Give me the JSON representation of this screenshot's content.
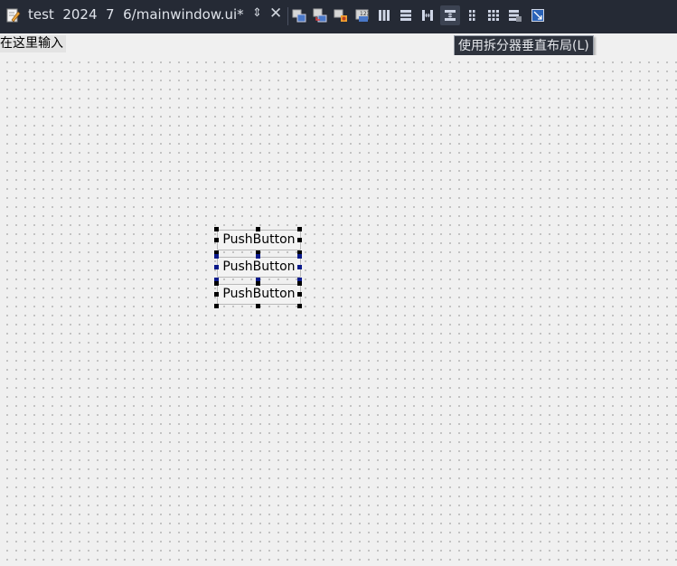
{
  "toolbar": {
    "document_title": "test  2024  7  6/mainwindow.ui*",
    "icons": [
      "edit-widgets-icon",
      "edit-signals-icon",
      "edit-buddies-icon",
      "edit-tab-order-icon",
      "layout-horizontal-icon",
      "layout-vertical-icon",
      "splitter-horizontal-icon",
      "splitter-vertical-icon",
      "layout-form-icon",
      "layout-grid-icon",
      "break-layout-icon",
      "adjust-size-icon"
    ]
  },
  "menubar": {
    "placeholder": "在这里输入"
  },
  "tooltip": {
    "text": "使用拆分器垂直布局(L)"
  },
  "form": {
    "buttons": [
      {
        "label": "PushButton"
      },
      {
        "label": "PushButton"
      },
      {
        "label": "PushButton"
      }
    ]
  }
}
